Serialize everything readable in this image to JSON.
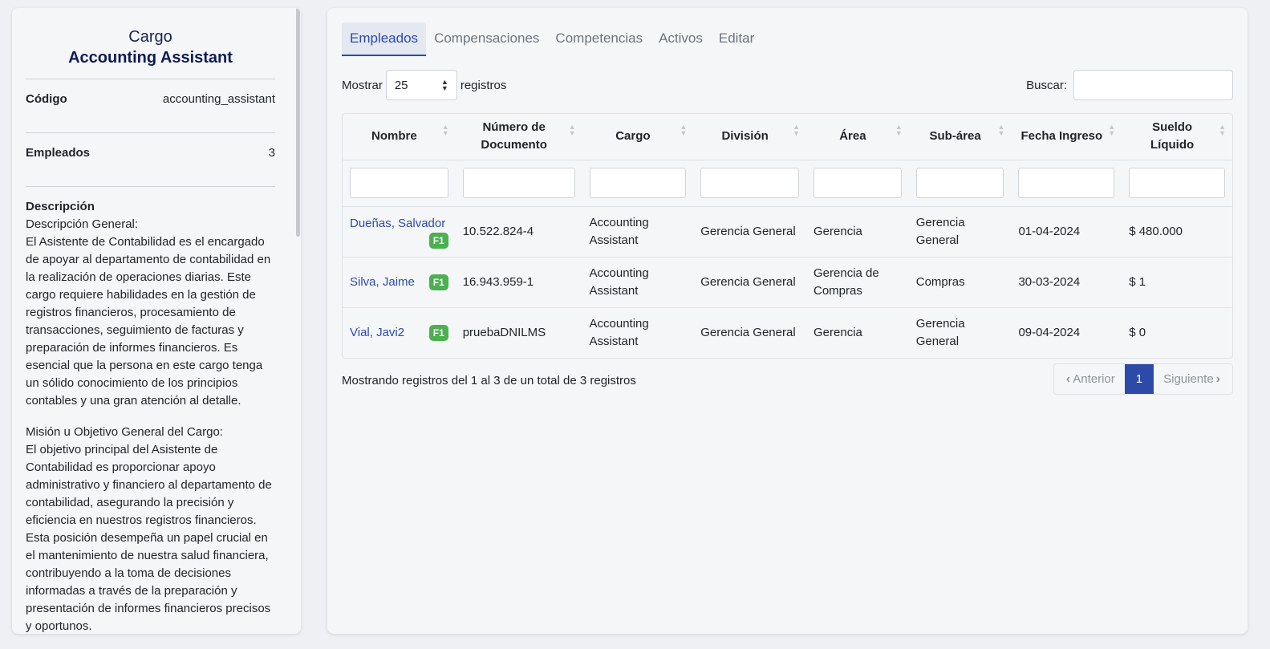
{
  "role_card": {
    "title_label": "Cargo",
    "title_name": "Accounting Assistant",
    "code_label": "Código",
    "code_value": "accounting_assistant",
    "employees_label": "Empleados",
    "employees_value": "3",
    "description_label": "Descripción",
    "description_general_heading": "Descripción General:",
    "description_general_text": "El Asistente de Contabilidad es el encargado de apoyar al departamento de contabilidad en la realización de operaciones diarias. Este cargo requiere habilidades en la gestión de registros financieros, procesamiento de transacciones, seguimiento de facturas y preparación de informes financieros. Es esencial que la persona en este cargo tenga un sólido conocimiento de los principios contables y una gran atención al detalle.",
    "mission_heading": "Misión u Objetivo General del Cargo:",
    "mission_text": "El objetivo principal del Asistente de Contabilidad es proporcionar apoyo administrativo y financiero al departamento de contabilidad, asegurando la precisión y eficiencia en nuestros registros financieros. Esta posición desempeña un papel crucial en el mantenimiento de nuestra salud financiera, contribuyendo a la toma de decisiones informadas a través de la preparación y presentación de informes financieros precisos y oportunos."
  },
  "tabs": [
    {
      "label": "Empleados",
      "active": true
    },
    {
      "label": "Compensaciones",
      "active": false
    },
    {
      "label": "Competencias",
      "active": false
    },
    {
      "label": "Activos",
      "active": false
    },
    {
      "label": "Editar",
      "active": false
    }
  ],
  "table_controls": {
    "show_label": "Mostrar",
    "page_size": "25",
    "records_label": "registros",
    "search_label": "Buscar:",
    "search_value": ""
  },
  "table": {
    "headers": [
      "Nombre",
      "Número de Documento",
      "Cargo",
      "División",
      "Área",
      "Sub-área",
      "Fecha Ingreso",
      "Sueldo Líquido"
    ],
    "rows": [
      {
        "name": "Dueñas, Salvador",
        "badge": "F1",
        "document": "10.522.824-4",
        "cargo": "Accounting Assistant",
        "division": "Gerencia General",
        "area": "Gerencia",
        "subarea": "Gerencia General",
        "date": "01-04-2024",
        "salary": "$ 480.000"
      },
      {
        "name": "Silva, Jaime",
        "badge": "F1",
        "document": "16.943.959-1",
        "cargo": "Accounting Assistant",
        "division": "Gerencia General",
        "area": "Gerencia de Compras",
        "subarea": "Compras",
        "date": "30-03-2024",
        "salary": "$ 1"
      },
      {
        "name": "Vial, Javi2",
        "badge": "F1",
        "document": "pruebaDNILMS",
        "cargo": "Accounting Assistant",
        "division": "Gerencia General",
        "area": "Gerencia",
        "subarea": "Gerencia General",
        "date": "09-04-2024",
        "salary": "$ 0"
      }
    ]
  },
  "footer": {
    "info": "Mostrando registros del 1 al 3 de un total de 3 registros",
    "prev_label": "Anterior",
    "current_page": "1",
    "next_label": "Siguiente"
  },
  "colors": {
    "accent": "#2d4aa8",
    "badge": "#4caf50",
    "title_dark": "#0f1a55"
  }
}
